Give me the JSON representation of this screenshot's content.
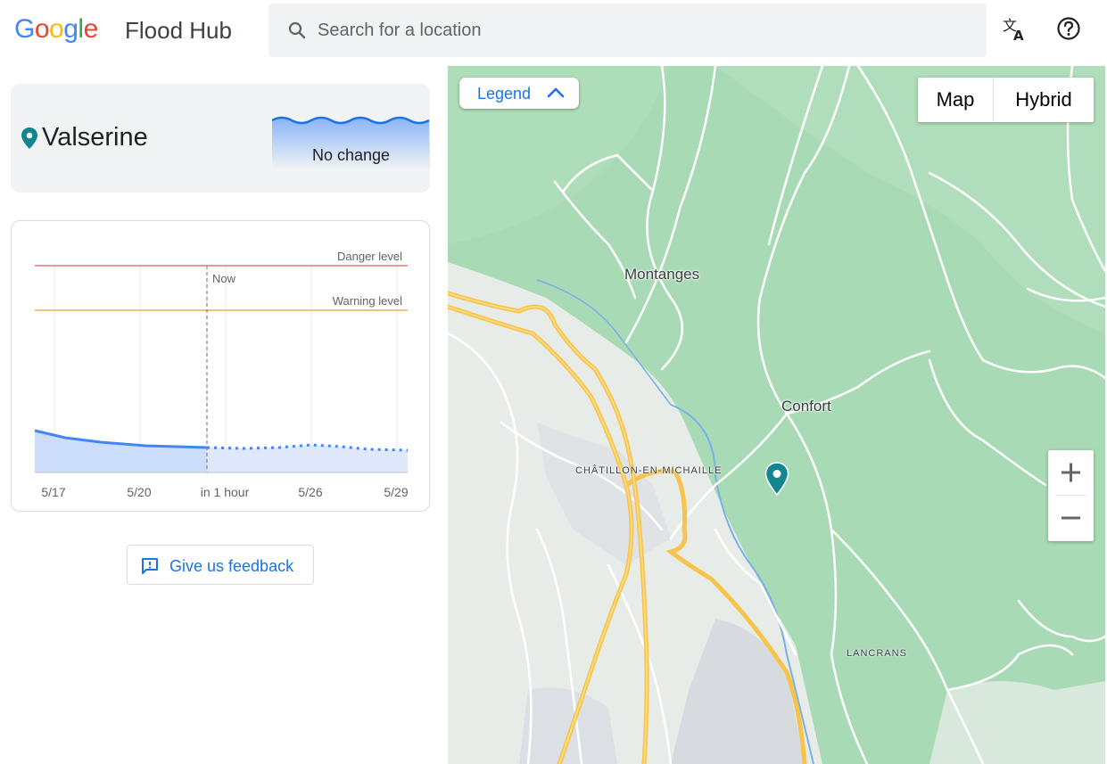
{
  "header": {
    "logo": "Google",
    "app_title": "Flood Hub",
    "search_placeholder": "Search for a location",
    "translate_icon": "translate-icon",
    "help_icon": "help-icon"
  },
  "location": {
    "name": "Valserine",
    "status": "No change",
    "pin_color": "#12858e"
  },
  "chart_data": {
    "type": "area",
    "x_tick_labels": [
      "5/17",
      "5/20",
      "in 1 hour",
      "5/26",
      "5/29"
    ],
    "threshold_lines": [
      {
        "label": "Danger level",
        "color": "#e8776e"
      },
      {
        "label": "Warning level",
        "color": "#f2a94e"
      }
    ],
    "now_label": "Now",
    "observed_color": "#4285f4",
    "forecast_style": "dotted"
  },
  "feedback": {
    "label": "Give us feedback",
    "icon": "feedback-icon"
  },
  "map": {
    "legend_label": "Legend",
    "map_types": [
      "Map",
      "Hybrid"
    ],
    "selected_map_type": "Map",
    "zoom_in": "+",
    "zoom_out": "−",
    "places": {
      "montanges": "Montanges",
      "confort": "Confort",
      "chatillon": "CHÂTILLON-EN-MICHAILLE",
      "lancrans": "LANCRANS"
    },
    "colors": {
      "forest": "#a8dab5",
      "urban": "#e8eaed",
      "road_major": "#f8c34a",
      "road_minor": "#ffffff",
      "water": "#7ab0e8"
    }
  }
}
